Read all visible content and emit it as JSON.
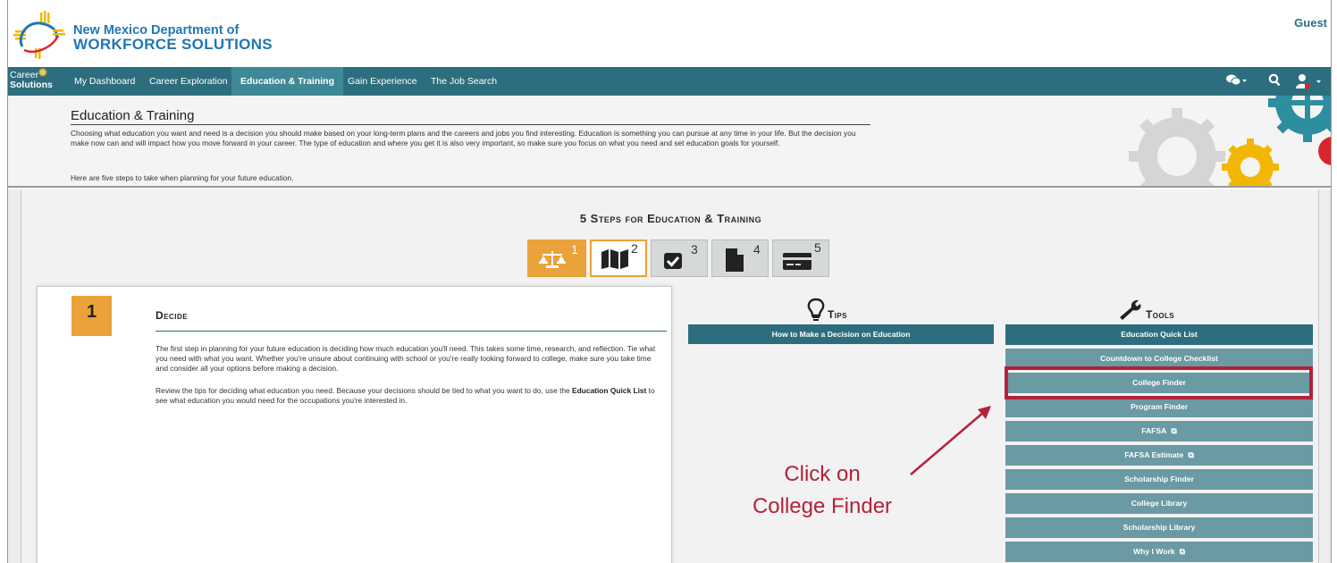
{
  "header": {
    "org_line1": "New Mexico Department of",
    "org_line2": "WORKFORCE SOLUTIONS",
    "user": "Guest"
  },
  "nav": {
    "brand_line1": "Career",
    "brand_line2": "Solutions",
    "items": [
      {
        "label": "My Dashboard",
        "active": false
      },
      {
        "label": "Career Exploration",
        "active": false
      },
      {
        "label": "Education & Training",
        "active": true
      },
      {
        "label": "Gain Experience",
        "active": false
      },
      {
        "label": "The Job Search",
        "active": false
      }
    ]
  },
  "intro": {
    "title": "Education & Training",
    "body": "Choosing what education you want and need is a decision you should make based on your long-term plans and the careers and jobs you find interesting. Education is something you can pursue at any time in your life. But the decision you make now can and will impact how you move forward in your career. The type of education and where you get it is also very important, so make sure you focus on what you need and set education goals for yourself.",
    "steps_text": "Here are five steps to take when planning for your future education."
  },
  "steps": {
    "title": "5 Steps for Education & Training",
    "buttons": [
      "1",
      "2",
      "3",
      "4",
      "5"
    ]
  },
  "card": {
    "number": "1",
    "title": "Decide",
    "p1": "The first step in planning for your future education is deciding how much education you'll need. This takes some time, research, and reflection. Tie what you need with what you want. Whether you're unsure about continuing with school or you're really looking forward to college, make sure you take time and consider all your options before making a decision.",
    "p2_before": "Review the tips for deciding what education you need. Because your decisions should be tied to what you want to do, use the ",
    "p2_bold": "Education Quick List",
    "p2_after": " to see what education you would need for the occupations you're interested in."
  },
  "tips": {
    "heading": "Tips",
    "items": [
      "How to Make a Decision on Education"
    ]
  },
  "tools": {
    "heading": "Tools",
    "items": [
      "Education Quick List",
      "Countdown to College Checklist",
      "College Finder",
      "Program Finder",
      "FAFSA",
      "FAFSA Estimate",
      "Scholarship Finder",
      "College Library",
      "Scholarship Library",
      "Why I Work"
    ]
  },
  "annotation": {
    "line1": "Click on",
    "line2": "College Finder"
  },
  "colors": {
    "nav": "#2d6e7e",
    "accent": "#eaa23a",
    "tool": "#6a9aa3",
    "highlight": "#b3223a"
  }
}
